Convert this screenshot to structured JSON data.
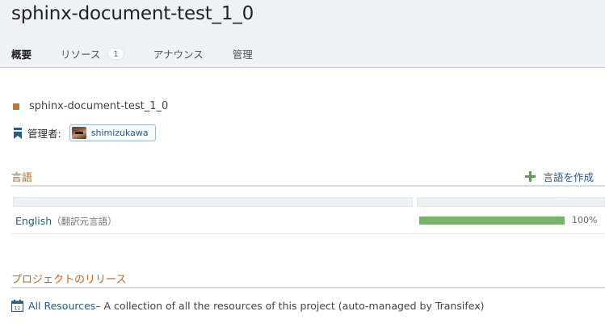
{
  "project": {
    "title": "sphinx-document-test_1_0",
    "name": "sphinx-document-test_1_0"
  },
  "tabs": [
    {
      "label": "概要",
      "active": true
    },
    {
      "label": "リソース",
      "badge": "1"
    },
    {
      "label": "アナウンス"
    },
    {
      "label": "管理"
    }
  ],
  "maintainers": {
    "label": "管理者:",
    "user": "shimizukawa"
  },
  "languages": {
    "title": "言語",
    "create_label": "言語を作成",
    "rows": [
      {
        "name": "English",
        "note": "（翻訳元言語）",
        "progress": 100,
        "progress_label": "100%"
      }
    ]
  },
  "releases": {
    "title": "プロジェクトのリリース",
    "items": [
      {
        "link": "All Resources",
        "description": " – A collection of all the resources of this project (auto-managed by Transifex)"
      }
    ]
  },
  "colors": {
    "accent": "#b86a24",
    "link": "#2a5b8a",
    "progress": "#79b26a",
    "add_icon": "#5aa24a"
  }
}
